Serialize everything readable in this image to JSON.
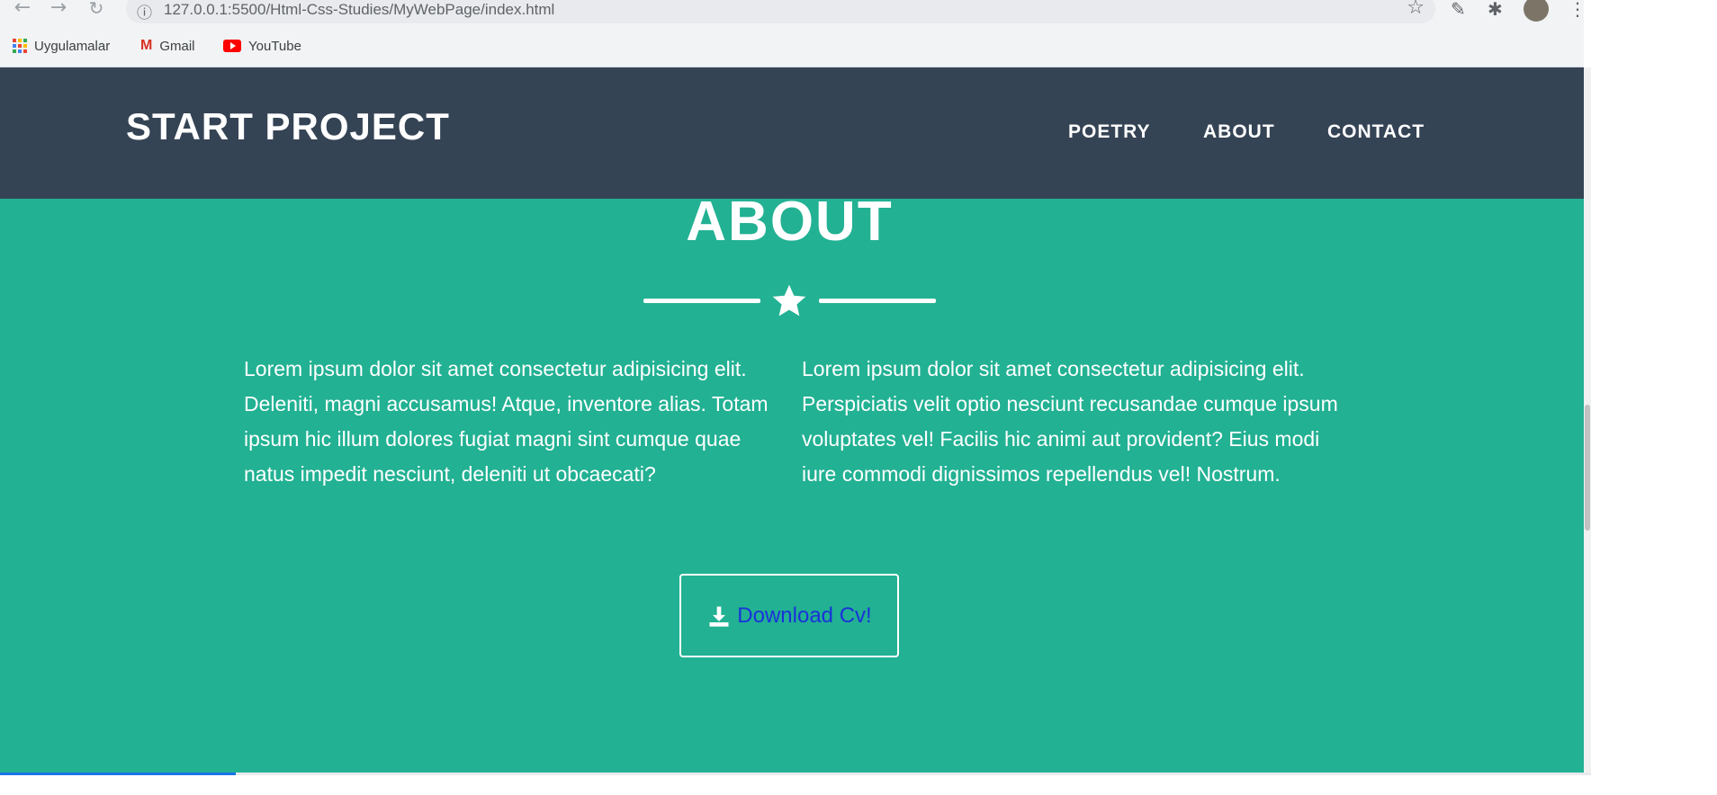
{
  "browser": {
    "url": "127.0.0.1:5500/Html-Css-Studies/MyWebPage/index.html",
    "bookmarks": [
      {
        "label": "Uygulamalar",
        "icon": "apps-grid-icon"
      },
      {
        "label": "Gmail",
        "icon": "gmail-icon"
      },
      {
        "label": "YouTube",
        "icon": "youtube-icon"
      }
    ]
  },
  "site": {
    "brand": "START PROJECT",
    "nav": [
      "POETRY",
      "ABOUT",
      "CONTACT"
    ],
    "about": {
      "title": "ABOUT",
      "col1": "Lorem ipsum dolor sit amet consectetur adipisicing elit. Deleniti, magni accusamus! Atque, inventore alias. Totam ipsum hic illum dolores fugiat magni sint cumque quae natus impedit nesciunt, deleniti ut obcaecati?",
      "col2": "Lorem ipsum dolor sit amet consectetur adipisicing elit. Perspiciatis velit optio nesciunt recusandae cumque ipsum voluptates vel! Facilis hic animi aut provident? Eius modi iure commodi dignissimos repellendus vel! Nostrum.",
      "button": "Download Cv!"
    }
  },
  "colors": {
    "header_bg": "#354455",
    "section_bg": "#22b193",
    "button_text": "#1a32d8"
  }
}
